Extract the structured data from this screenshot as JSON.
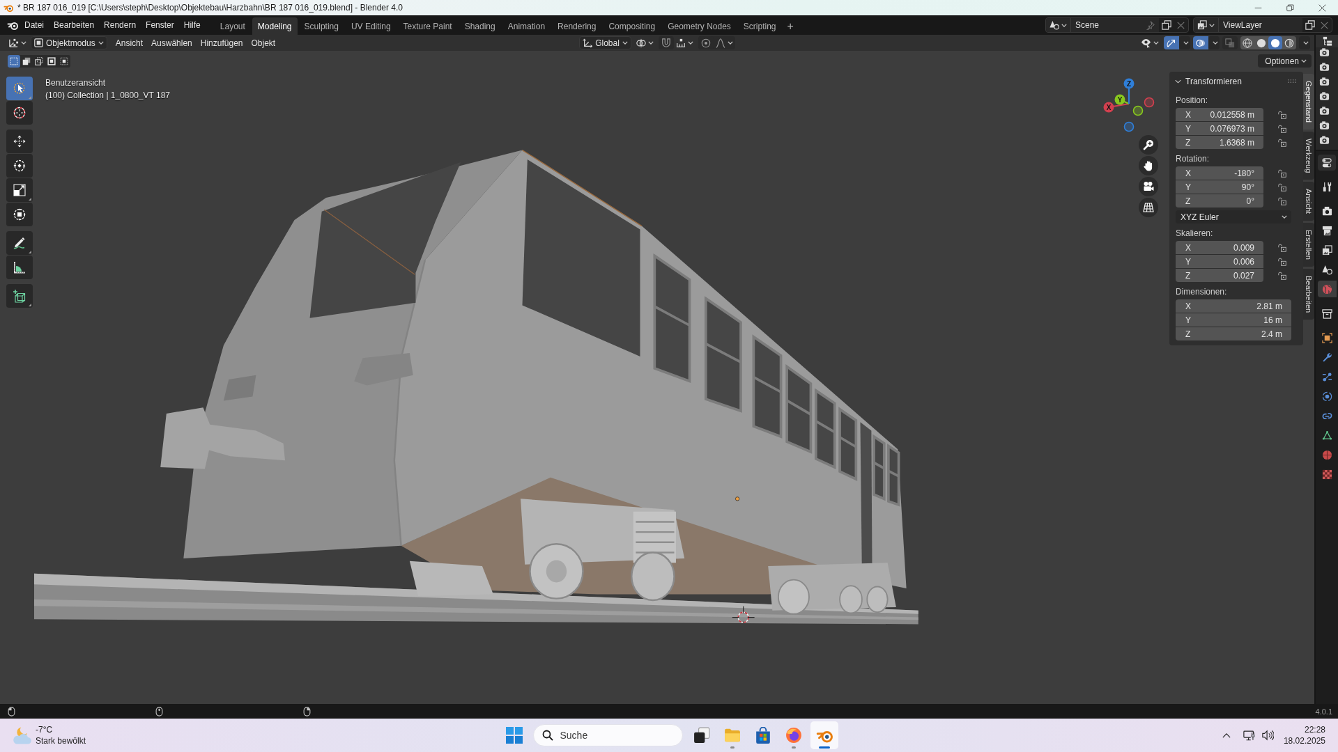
{
  "window": {
    "title": "* BR 187 016_019 [C:\\Users\\steph\\Desktop\\Objektebau\\Harzbahn\\BR 187 016_019.blend] - Blender 4.0"
  },
  "menu": [
    "Datei",
    "Bearbeiten",
    "Rendern",
    "Fenster",
    "Hilfe"
  ],
  "workspaces": [
    {
      "label": "Layout",
      "selected": false
    },
    {
      "label": "Modeling",
      "selected": true
    },
    {
      "label": "Sculpting",
      "selected": false
    },
    {
      "label": "UV Editing",
      "selected": false
    },
    {
      "label": "Texture Paint",
      "selected": false
    },
    {
      "label": "Shading",
      "selected": false
    },
    {
      "label": "Animation",
      "selected": false
    },
    {
      "label": "Rendering",
      "selected": false
    },
    {
      "label": "Compositing",
      "selected": false
    },
    {
      "label": "Geometry Nodes",
      "selected": false
    },
    {
      "label": "Scripting",
      "selected": false
    }
  ],
  "add_workspace": "+",
  "scene": {
    "name": "Scene"
  },
  "view_layer": {
    "name": "ViewLayer"
  },
  "header": {
    "mode": "Objektmodus",
    "menus": [
      "Ansicht",
      "Auswählen",
      "Hinzufügen",
      "Objekt"
    ],
    "orientation": "Global",
    "snap_on": false,
    "proportional_on": false,
    "gizmos_on": true,
    "overlays_on": true,
    "xray_on": false,
    "shading_modes": [
      {
        "kind": "wireframe",
        "selected": false
      },
      {
        "kind": "solid",
        "selected": false
      },
      {
        "kind": "material",
        "selected": true
      },
      {
        "kind": "rendered",
        "selected": false
      }
    ]
  },
  "tool_settings": {
    "select_modes": [
      {
        "kind": "set",
        "selected": true
      },
      {
        "kind": "extend",
        "selected": false
      },
      {
        "kind": "subtract",
        "selected": false
      },
      {
        "kind": "invert",
        "selected": false
      },
      {
        "kind": "intersect",
        "selected": false
      }
    ],
    "options": "Optionen"
  },
  "toolbar": [
    {
      "tools": [
        {
          "kind": "select_box",
          "selected": true,
          "more": true
        },
        {
          "kind": "cursor",
          "selected": false,
          "more": false
        }
      ]
    },
    {
      "tools": [
        {
          "kind": "move",
          "selected": false,
          "more": false
        },
        {
          "kind": "rotate",
          "selected": false,
          "more": false
        },
        {
          "kind": "scale",
          "selected": false,
          "more": true
        },
        {
          "kind": "transform",
          "selected": false,
          "more": false
        }
      ]
    },
    {
      "tools": [
        {
          "kind": "annotate",
          "selected": false,
          "more": true
        },
        {
          "kind": "measure",
          "selected": false,
          "more": false
        }
      ]
    },
    {
      "tools": [
        {
          "kind": "add_cube",
          "selected": false,
          "more": true
        }
      ]
    }
  ],
  "viewport": {
    "view_name": "Benutzeransicht",
    "info": "(100) Collection | 1_0800_VT 187"
  },
  "nav_gizmo": {
    "axes": [
      {
        "label": "X",
        "color": "#d3404f"
      },
      {
        "label": "Y",
        "color": "#88c81e"
      },
      {
        "label": "Z",
        "color": "#2f7fd9"
      }
    ]
  },
  "sidebar": {
    "panel": {
      "title": "Transformieren",
      "expanded": true,
      "groups": [
        {
          "label": "Position:",
          "fields": [
            {
              "axis": "X",
              "value": "0.012558 m",
              "locked": false
            },
            {
              "axis": "Y",
              "value": "0.076973 m",
              "locked": false
            },
            {
              "axis": "Z",
              "value": "1.6368 m",
              "locked": false
            }
          ]
        },
        {
          "label": "Rotation:",
          "fields": [
            {
              "axis": "X",
              "value": "-180°",
              "locked": false
            },
            {
              "axis": "Y",
              "value": "90°",
              "locked": false
            },
            {
              "axis": "Z",
              "value": "0°",
              "locked": false
            }
          ],
          "dropdown": "XYZ Euler"
        },
        {
          "label": "Skalieren:",
          "fields": [
            {
              "axis": "X",
              "value": "0.009",
              "locked": false
            },
            {
              "axis": "Y",
              "value": "0.006",
              "locked": false
            },
            {
              "axis": "Z",
              "value": "0.027",
              "locked": false
            }
          ]
        },
        {
          "label": "Dimensionen:",
          "fields": [
            {
              "axis": "X",
              "value": "2.81 m"
            },
            {
              "axis": "Y",
              "value": "16 m"
            },
            {
              "axis": "Z",
              "value": "2.4 m"
            }
          ]
        }
      ]
    },
    "tabs": [
      {
        "label": "Gegenstand",
        "selected": true
      },
      {
        "label": "Werkzeug",
        "selected": false
      },
      {
        "label": "Ansicht",
        "selected": false
      },
      {
        "label": "Erstellen",
        "selected": false
      },
      {
        "label": "Bearbeiten",
        "selected": false
      }
    ]
  },
  "properties_tabs": [
    {
      "tabs": [
        {
          "kind": "tool",
          "selected": false
        }
      ]
    },
    {
      "tabs": [
        {
          "kind": "render",
          "selected": false
        },
        {
          "kind": "output",
          "selected": false
        },
        {
          "kind": "view_layer",
          "selected": false
        },
        {
          "kind": "scene",
          "selected": false
        },
        {
          "kind": "world",
          "selected": true
        }
      ]
    },
    {
      "tabs": [
        {
          "kind": "collection",
          "selected": false
        }
      ]
    },
    {
      "tabs": [
        {
          "kind": "object",
          "selected": false
        },
        {
          "kind": "modifiers",
          "selected": false
        },
        {
          "kind": "particles",
          "selected": false
        },
        {
          "kind": "physics",
          "selected": false
        },
        {
          "kind": "constraints",
          "selected": false
        },
        {
          "kind": "data",
          "selected": false
        },
        {
          "kind": "material",
          "selected": false
        },
        {
          "kind": "texture",
          "selected": false
        }
      ]
    }
  ],
  "status_bar": {
    "version": "4.0.1"
  },
  "taskbar": {
    "weather": {
      "temperature": "-7°C",
      "condition": "Stark bewölkt"
    },
    "search": {
      "placeholder": "Suche"
    },
    "apps": [
      {
        "kind": "task_view",
        "running": false,
        "selected": false
      },
      {
        "kind": "file_explorer",
        "running": true,
        "selected": false
      },
      {
        "kind": "store",
        "running": false,
        "selected": false
      },
      {
        "kind": "firefox",
        "running": true,
        "selected": false
      },
      {
        "kind": "blender",
        "running": true,
        "selected": true
      }
    ],
    "clock": {
      "time": "22:28",
      "date": "18.02.2025"
    }
  }
}
